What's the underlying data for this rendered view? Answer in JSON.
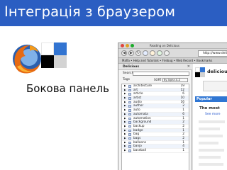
{
  "slide": {
    "title": "Інтеграція з браузером",
    "subtitle": "Бокова панель"
  },
  "screenshot": {
    "window_title": "Reading on Delicious",
    "toolbar": {
      "back": "◀",
      "forward": "▶",
      "reload": "↻",
      "url": "http://www.delicious.com/"
    },
    "bookmarks_bar": "Mafia • Help and Tutorials • Firebug • Web Record • Bookmarks",
    "sidebar": {
      "header": "Delicious",
      "close": "✕",
      "search_label": "Search:",
      "tags_label": "Tags",
      "sort_label": "SORT",
      "sort_value": "By Alpha A–Z",
      "tags": [
        {
          "name": "architecture",
          "count": "19"
        },
        {
          "name": "art",
          "count": "12"
        },
        {
          "name": "article",
          "count": "6"
        },
        {
          "name": "artist",
          "count": "10"
        },
        {
          "name": "audio",
          "count": "16"
        },
        {
          "name": "author",
          "count": "2"
        },
        {
          "name": "auto",
          "count": "1"
        },
        {
          "name": "automata",
          "count": "6"
        },
        {
          "name": "automation",
          "count": "1"
        },
        {
          "name": "background",
          "count": "2"
        },
        {
          "name": "backup",
          "count": "2"
        },
        {
          "name": "badge",
          "count": "1"
        },
        {
          "name": "bag",
          "count": "2"
        },
        {
          "name": "bags",
          "count": "2"
        },
        {
          "name": "balloons",
          "count": "1"
        },
        {
          "name": "banjo",
          "count": "4"
        },
        {
          "name": "baseball",
          "count": "1"
        }
      ]
    },
    "content": {
      "brand": "delicious",
      "popular_tab": "Popular",
      "the_most": "The most",
      "see_more": "See more"
    }
  },
  "colors": {
    "title_bar": "#2b5ec2",
    "popular_tab": "#2f76d3",
    "delicious_blue": "#3274d1",
    "delicious_black": "#000000",
    "delicious_gray": "#d3d3d3"
  },
  "icons": [
    "firefox-logo",
    "delicious-logo"
  ]
}
